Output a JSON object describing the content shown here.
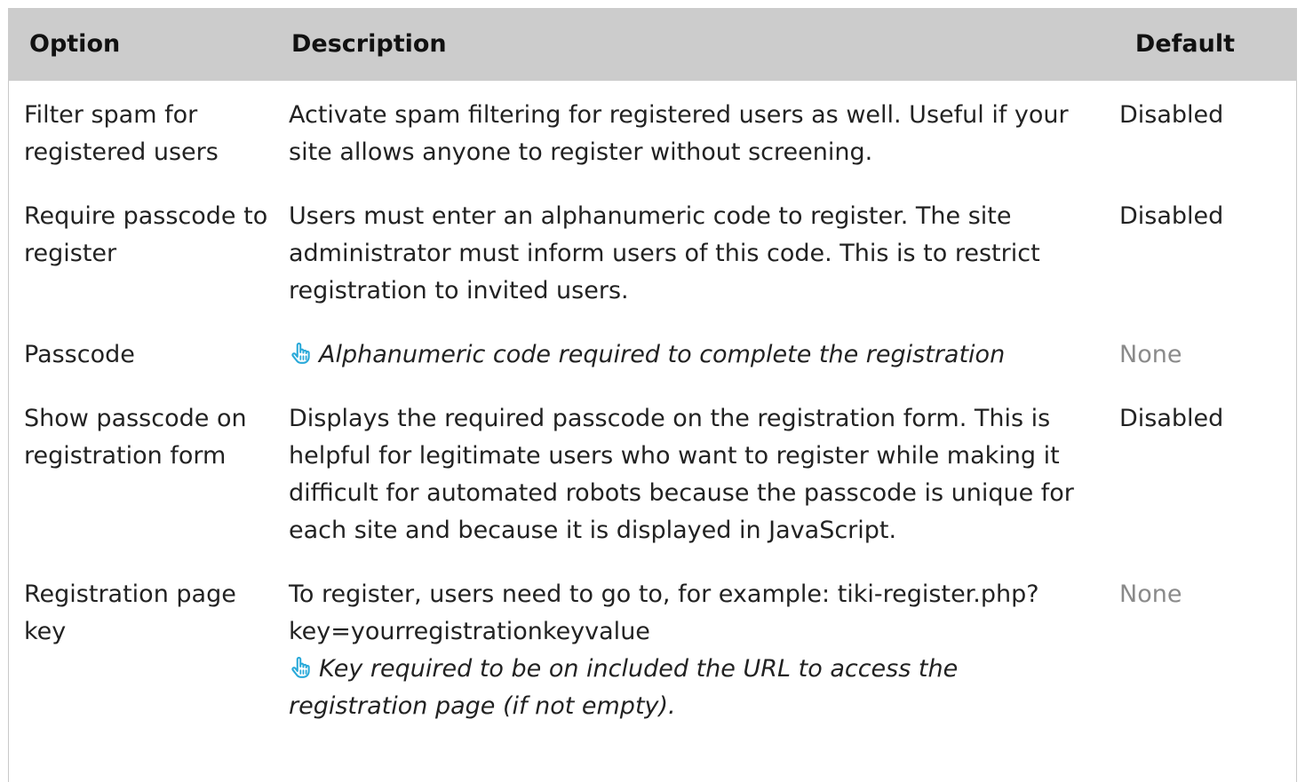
{
  "table": {
    "headers": {
      "option": "Option",
      "description": "Description",
      "default": "Default"
    },
    "rows": [
      {
        "option": "Filter spam for registered users",
        "description": "Activate spam filtering for registered users as well. Useful if your site allows anyone to register without screening.",
        "hint": "",
        "default": "Disabled",
        "default_muted": false
      },
      {
        "option": "Require passcode to register",
        "description": "Users must enter an alphanumeric code to register. The site administrator must inform users of this code. This is to restrict registration to invited users.",
        "hint": "",
        "default": "Disabled",
        "default_muted": false
      },
      {
        "option": "Passcode",
        "description": "",
        "hint": "Alphanumeric code required to complete the registration",
        "default": "None",
        "default_muted": true
      },
      {
        "option": "Show passcode on registration form",
        "description": "Displays the required passcode on the registration form. This is helpful for legitimate users who want to register while making it difficult for automated robots because the passcode is unique for each site and because it is displayed in JavaScript.",
        "hint": "",
        "default": "Disabled",
        "default_muted": false
      },
      {
        "option": "Registration page key",
        "description": "To register, users need to go to, for example: tiki-register.php?key=yourregistrationkeyvalue",
        "hint": "Key required to be on included the URL to access the registration page (if not empty).",
        "default": "None",
        "default_muted": true
      }
    ]
  },
  "icons": {
    "hint": "pointing-hand-icon"
  },
  "colors": {
    "header_bg": "#cccccc",
    "muted_text": "#8a8a8a",
    "hint_icon": "#29a9d9"
  }
}
